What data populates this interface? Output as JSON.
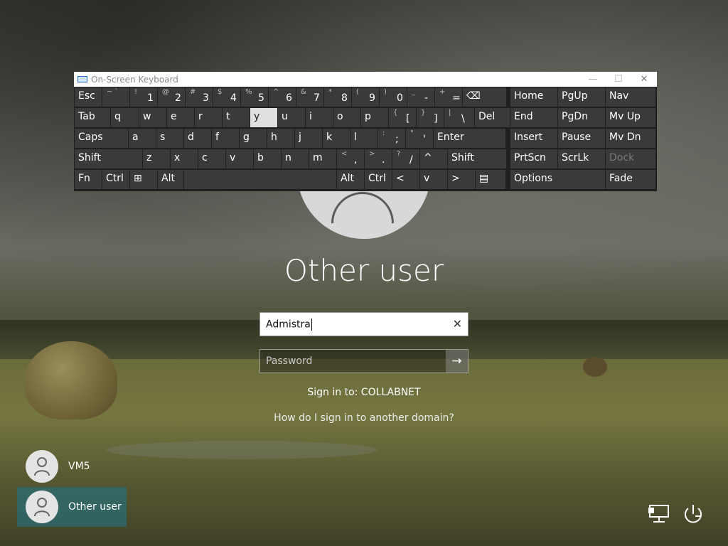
{
  "osk": {
    "title": "On-Screen Keyboard",
    "controls": {
      "minimize": "—",
      "maximize": "☐",
      "close": "✕"
    },
    "row1": [
      {
        "label": "Esc"
      },
      {
        "sym": "~ `",
        "num": ""
      },
      {
        "sym": "!",
        "num": "1"
      },
      {
        "sym": "@",
        "num": "2"
      },
      {
        "sym": "#",
        "num": "3"
      },
      {
        "sym": "$",
        "num": "4"
      },
      {
        "sym": "%",
        "num": "5"
      },
      {
        "sym": "^",
        "num": "6"
      },
      {
        "sym": "&",
        "num": "7"
      },
      {
        "sym": "*",
        "num": "8"
      },
      {
        "sym": "(",
        "num": "9"
      },
      {
        "sym": ")",
        "num": "0"
      },
      {
        "sym": "_",
        "num": "-"
      },
      {
        "sym": "+",
        "num": "="
      },
      {
        "label": "⌫"
      },
      {
        "label": "Home"
      },
      {
        "label": "PgUp"
      },
      {
        "label": "Nav"
      }
    ],
    "row2": [
      "Tab",
      "q",
      "w",
      "e",
      "r",
      "t",
      "y",
      "u",
      "i",
      "o",
      "p",
      "[",
      "]",
      "\\",
      "Del",
      "End",
      "PgDn",
      "Mv Up"
    ],
    "row2_syms": {
      "[": "{",
      "]": "}",
      "\\": "|"
    },
    "row3": [
      "Caps",
      "a",
      "s",
      "d",
      "f",
      "g",
      "h",
      "j",
      "k",
      "l",
      ";",
      "'",
      "Enter",
      "Insert",
      "Pause",
      "Mv Dn"
    ],
    "row3_syms": {
      ";": ":",
      "'": "\""
    },
    "row4": [
      "Shift",
      "z",
      "x",
      "c",
      "v",
      "b",
      "n",
      "m",
      ",",
      ".",
      "/",
      "^",
      "Shift",
      "PrtScn",
      "ScrLk",
      "Dock"
    ],
    "row4_syms": {
      ",": "<",
      ".": ">",
      "/": "?"
    },
    "row5": [
      "Fn",
      "Ctrl",
      "⊞",
      "Alt",
      "",
      "Alt",
      "Ctrl",
      "<",
      "v",
      ">",
      "▤",
      "Options",
      "Fade"
    ],
    "active_key": "y",
    "disabled_keys": [
      "Dock"
    ]
  },
  "login": {
    "title": "Other user",
    "username_value": "Admistra",
    "clear_glyph": "✕",
    "password_placeholder": "Password",
    "submit_glyph": "→",
    "sign_in_to": "Sign in to: COLLABNET",
    "other_domain_link": "How do I sign in to another domain?"
  },
  "users": [
    {
      "name": "VM5",
      "selected": false
    },
    {
      "name": "Other user",
      "selected": true
    }
  ],
  "tray": [
    "network-icon",
    "power-icon"
  ]
}
